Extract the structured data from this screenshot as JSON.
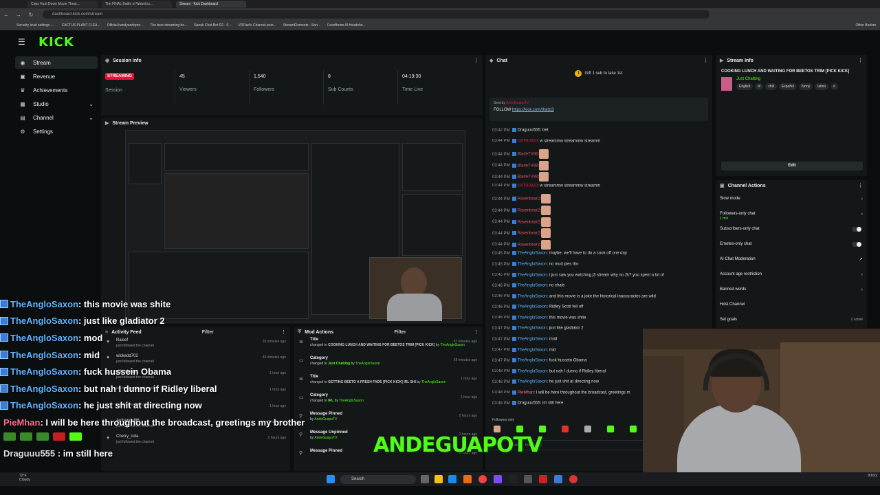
{
  "browser": {
    "tabs": [
      "Cops Hunt Down Movie Theat...",
      "The FINAL Battle of Waterloo...",
      "Stream - Kick Dashboard"
    ],
    "url": "dashboard.kick.com/stream",
    "bookmarks": [
      "Security level settings -...",
      "CACTUS PLANT FLEA...",
      "Official handyandepro...",
      "The best streaming bo...",
      "Speak Chat Bot R2 - 0...",
      "VRFlad's Channel poin...",
      "StreamElements - Son...",
      "FaceBoom AI Headsho...",
      "Other Bookm"
    ]
  },
  "brand": {
    "logo": "KICK",
    "accent": "#53fc18",
    "live_color": "#e9113c"
  },
  "sidebar": {
    "items": [
      {
        "label": "Stream",
        "icon": "broadcast-icon"
      },
      {
        "label": "Revenue",
        "icon": "dollar-icon"
      },
      {
        "label": "Achievements",
        "icon": "trophy-icon"
      },
      {
        "label": "Studio",
        "icon": "studio-icon"
      },
      {
        "label": "Channel",
        "icon": "channel-icon"
      },
      {
        "label": "Settings",
        "icon": "gear-icon"
      }
    ]
  },
  "session": {
    "title": "Session info",
    "status": "STREAMING",
    "status_label": "Session",
    "viewers": "45",
    "viewers_label": "Viewers",
    "followers": "1,540",
    "followers_label": "Followers",
    "subs": "8",
    "subs_label": "Sub Counts",
    "time": "04:19:30",
    "time_label": "Time Live"
  },
  "preview": {
    "title": "Stream Preview"
  },
  "activity": {
    "title": "Activity Feed",
    "filter": "Filter",
    "items": [
      {
        "user": "Raisef",
        "action": "just followed the channel",
        "time": "35 minutes ago"
      },
      {
        "user": "wickedd702",
        "action": "just followed the channel",
        "time": "40 minutes ago"
      },
      {
        "user": "xNick1cola",
        "action": "just followed the channel",
        "time": "1 hour ago"
      },
      {
        "user": "",
        "action": "just followed the channel",
        "time": "1 hour ago"
      },
      {
        "user": "",
        "action": "just followed the channel",
        "time": "1 hour ago"
      },
      {
        "user": "Archangel86",
        "action": "just followed the channel",
        "time": "2 hours ago"
      },
      {
        "user": "Cherry_cola",
        "action": "just followed the channel",
        "time": "2 hours ago"
      }
    ]
  },
  "mod": {
    "title": "Mod Actions",
    "filter": "Filter",
    "items": [
      {
        "head": "Title",
        "pre": "changed to ",
        "val": "COOKING LUNCH AND WAITING FOR BEETOS TRIM [PICK KICK]",
        "by": " by ",
        "who": "TheAngloSaxon",
        "time": "57 minutes ago"
      },
      {
        "head": "Category",
        "pre": "changed to ",
        "val": "Just Chatting",
        "by": " by ",
        "who": "TheAngloSaxon",
        "time": "58 minutes ago"
      },
      {
        "head": "Title",
        "pre": "changed to ",
        "val": "GETTING BEETO A FRESH FADE [PICK KICK] IRL SHI",
        "by": " by ",
        "who": "TheAngloSaxon",
        "time": "1 hour ago"
      },
      {
        "head": "Category",
        "pre": "changed to ",
        "val": "IRL",
        "by": " by ",
        "who": "TheAngloSaxon",
        "time": "1 hour ago"
      },
      {
        "head": "Message Pinned",
        "pre": "by ",
        "val": "",
        "by": "",
        "who": "AndeGuapoTV",
        "time": "2 hours ago"
      },
      {
        "head": "Message Unpinned",
        "pre": "by ",
        "val": "",
        "by": "",
        "who": "AndeGuapoTV",
        "time": "2 hours ago"
      },
      {
        "head": "Message Pinned",
        "pre": "",
        "val": "",
        "by": "",
        "who": "",
        "time": "3 hours ago"
      }
    ]
  },
  "chat": {
    "title": "Chat",
    "gift": "Gift 1 sub to take 1st",
    "pinned_by": "Sent by",
    "pinned_user": "AndeGuapoTV",
    "pinned_msg": "FOLLOW",
    "pinned_link": "https://kick.com/thatzj3",
    "messages": [
      {
        "time": "03:42 PM",
        "user": "Draguuu555",
        "color": "#ddd",
        "text": ": bet"
      },
      {
        "time": "03:44 PM",
        "user": "NATR0820",
        "color": "#e9113c",
        "text": ": w streammw streammw streamm"
      },
      {
        "time": "03:44 PM",
        "user": "BladeTV88",
        "color": "#e05060",
        "text": ":"
      },
      {
        "time": "03:44 PM",
        "user": "BladeTV88",
        "color": "#e05060",
        "text": ":"
      },
      {
        "time": "03:44 PM",
        "user": "BladeTV88",
        "color": "#e05060",
        "text": ":"
      },
      {
        "time": "03:44 PM",
        "user": "NATR0820",
        "color": "#e9113c",
        "text": ": w streammw streammw streamm"
      },
      {
        "time": "03:44 PM",
        "user": "Ravenbear2",
        "color": "#e05060",
        "text": ":"
      },
      {
        "time": "03:44 PM",
        "user": "Ravenbear2",
        "color": "#e05060",
        "text": ":"
      },
      {
        "time": "03:44 PM",
        "user": "Ravenbear2",
        "color": "#e05060",
        "text": ":"
      },
      {
        "time": "03:44 PM",
        "user": "Ravenbear2",
        "color": "#e05060",
        "text": ":"
      },
      {
        "time": "03:44 PM",
        "user": "Ravenbear2",
        "color": "#e05060",
        "text": ":"
      },
      {
        "time": "03:45 PM",
        "user": "TheAngloSaxon",
        "color": "#5eb4ff",
        "text": ": maybe, we'll have to do a cook off one day"
      },
      {
        "time": "03:45 PM",
        "user": "TheAngloSaxon",
        "color": "#5eb4ff",
        "text": ": no mud pies tho"
      },
      {
        "time": "03:45 PM",
        "user": "TheAngloSaxon",
        "color": "#5eb4ff",
        "text": ": i just saw you watching j3 stream why no 2k? you spent a lot of"
      },
      {
        "time": "03:46 PM",
        "user": "TheAngloSaxon",
        "color": "#5eb4ff",
        "text": ": no chale"
      },
      {
        "time": "03:46 PM",
        "user": "TheAngloSaxon",
        "color": "#5eb4ff",
        "text": ": and this movie is a joke the historical inaccuracies are wild"
      },
      {
        "time": "03:46 PM",
        "user": "TheAngloSaxon",
        "color": "#5eb4ff",
        "text": ": Ridley Scott fell off"
      },
      {
        "time": "03:46 PM",
        "user": "TheAngloSaxon",
        "color": "#5eb4ff",
        "text": ": this movie was shite"
      },
      {
        "time": "03:47 PM",
        "user": "TheAngloSaxon",
        "color": "#5eb4ff",
        "text": ": just like gladiator 2"
      },
      {
        "time": "03:47 PM",
        "user": "TheAngloSaxon",
        "color": "#5eb4ff",
        "text": ": mod"
      },
      {
        "time": "03:47 PM",
        "user": "TheAngloSaxon",
        "color": "#5eb4ff",
        "text": ": mid"
      },
      {
        "time": "03:47 PM",
        "user": "TheAngloSaxon",
        "color": "#5eb4ff",
        "text": ": fuck hussein Obama"
      },
      {
        "time": "03:48 PM",
        "user": "TheAngloSaxon",
        "color": "#5eb4ff",
        "text": ": but nah I dunno if Ridley liberal"
      },
      {
        "time": "03:48 PM",
        "user": "TheAngloSaxon",
        "color": "#5eb4ff",
        "text": ": he just shit at directing now"
      },
      {
        "time": "03:48 PM",
        "user": "PieMhan",
        "color": "#ff6a8a",
        "text": ": I will be here throughout the broadcast, greetings m"
      },
      {
        "time": "03:48 PM",
        "user": "Draguuu555",
        "color": "#ddd",
        "text": ": im still here"
      }
    ],
    "followers_only": "Followers only",
    "input_placeholder": "Send a message"
  },
  "stream_info": {
    "title": "Stream Info",
    "stream_title": "COOKING LUNCH AND WAITING FOR BEETOS TRIM [PICK KICK]",
    "category": "Just Chatting",
    "tags": [
      "English",
      "irl",
      "chill",
      "Español",
      "funny",
      "latino",
      "ri"
    ],
    "edit": "Edit"
  },
  "channel_actions": {
    "title": "Channel Actions",
    "items": [
      {
        "label": "Slow mode",
        "kind": "arrow",
        "sub": ""
      },
      {
        "label": "Followers-only chat",
        "kind": "arrow",
        "sub": "1 min"
      },
      {
        "label": "Subscribers-only chat",
        "kind": "toggle",
        "sub": ""
      },
      {
        "label": "Emotes-only chat",
        "kind": "toggle",
        "sub": ""
      },
      {
        "label": "AI Chat Moderation",
        "kind": "external",
        "sub": ""
      },
      {
        "label": "Account age restriction",
        "kind": "arrow",
        "sub": ""
      },
      {
        "label": "Banned words",
        "kind": "arrow",
        "sub": ""
      },
      {
        "label": "Host Channel",
        "kind": "none",
        "sub": ""
      },
      {
        "label": "Set goals",
        "kind": "count",
        "sub": "",
        "count": "2 active"
      }
    ]
  },
  "overlay_chat": [
    {
      "user": "TheAngloSaxon",
      "text": " : this movie was shite",
      "cls": "name-anglo",
      "badge": true
    },
    {
      "user": "TheAngloSaxon",
      "text": " : just like gladiator 2",
      "cls": "name-anglo",
      "badge": true
    },
    {
      "user": "TheAngloSaxon",
      "text": " : mod",
      "cls": "name-anglo",
      "badge": true
    },
    {
      "user": "TheAngloSaxon",
      "text": " : mid",
      "cls": "name-anglo",
      "badge": true
    },
    {
      "user": "TheAngloSaxon",
      "text": " : fuck hussein Obama",
      "cls": "name-anglo",
      "badge": true
    },
    {
      "user": "TheAngloSaxon",
      "text": " : but nah I dunno if Ridley liberal",
      "cls": "name-anglo",
      "badge": true
    },
    {
      "user": "TheAngloSaxon",
      "text": " : he just shit at directing now",
      "cls": "name-anglo",
      "badge": true
    },
    {
      "user": "PieMhan",
      "text": " : I will be here throughout the broadcast, greetings my brother",
      "cls": "name-pie",
      "badge": false
    }
  ],
  "overlay_last": {
    "user": "Draguuu555",
    "text": " : im still here"
  },
  "watermark": "ANDEGUAPOTV",
  "taskbar": {
    "weather_temp": "72°F",
    "weather_cond": "Cloudy",
    "search": "Search",
    "date": "9/16/2"
  }
}
